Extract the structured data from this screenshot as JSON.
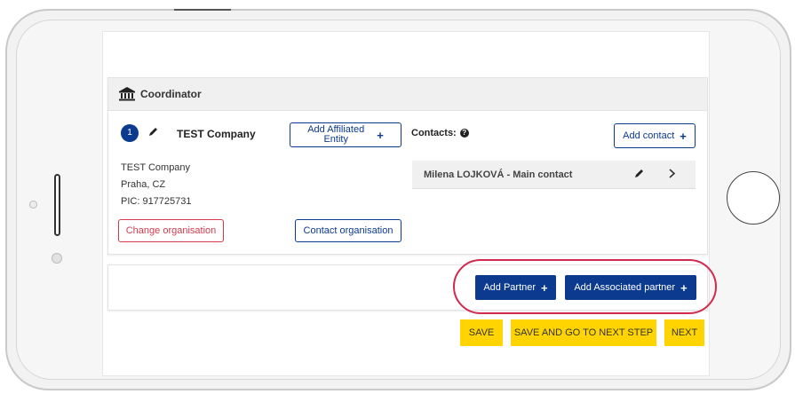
{
  "coordinator": {
    "title": "Coordinator",
    "badge_number": "1",
    "company_name": "TEST Company",
    "add_affiliated_label_line1": "Add Affiliated",
    "add_affiliated_label_line2": "Entity",
    "address_lines": [
      "TEST Company",
      "Praha, CZ",
      "PIC: 917725731"
    ],
    "change_org_label": "Change organisation",
    "contact_org_label": "Contact organisation",
    "contacts_label": "Contacts:",
    "add_contact_label": "Add contact",
    "contact_entry": "Milena LOJKOVÁ - Main contact"
  },
  "partners": {
    "add_partner_label": "Add Partner",
    "add_associated_label": "Add Associated partner"
  },
  "footer": {
    "save_label": "SAVE",
    "save_next_label": "SAVE AND GO TO NEXT STEP",
    "next_label": "NEXT"
  },
  "icons": {
    "institution": "institution-icon",
    "pencil": "pencil-icon",
    "plus": "plus-icon",
    "chevron": "chevron-right-icon",
    "help": "help-icon"
  },
  "colors": {
    "primary": "#0b3a8f",
    "danger": "#d33a4a",
    "highlight": "#d12a4c",
    "warning": "#ffd400"
  }
}
